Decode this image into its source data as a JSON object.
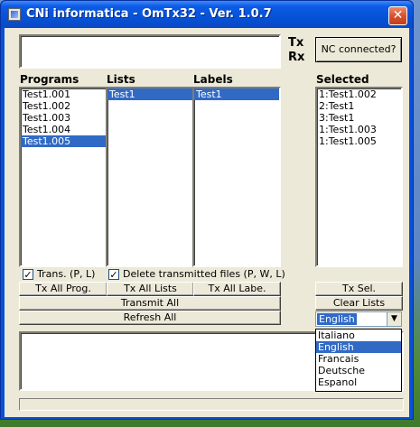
{
  "window": {
    "title": "CNi informatica - OmTx32 - Ver. 1.0.7",
    "close_glyph": "✕"
  },
  "indicators": {
    "tx": "Tx",
    "rx": "Rx"
  },
  "nc_button": "NC connected?",
  "columns": {
    "programs": {
      "label": "Programs",
      "items": [
        "Test1.001",
        "Test1.002",
        "Test1.003",
        "Test1.004",
        "Test1.005"
      ],
      "selected": "Test1.005"
    },
    "lists": {
      "label": "Lists",
      "items": [
        "Test1"
      ],
      "selected": "Test1"
    },
    "labels": {
      "label": "Labels",
      "items": [
        "Test1"
      ],
      "selected": "Test1"
    },
    "selected": {
      "label": "Selected",
      "items": [
        "1:Test1.002",
        "2:Test1",
        "3:Test1",
        "1:Test1.003",
        "1:Test1.005"
      ]
    }
  },
  "checkboxes": {
    "trans": {
      "label": "Trans. (P, L)",
      "checked": true
    },
    "delete": {
      "label": "Delete transmitted files (P, W, L)",
      "checked": true
    }
  },
  "buttons": {
    "tx_all_prog": "Tx All Prog.",
    "tx_all_lists": "Tx All Lists",
    "tx_all_labels": "Tx All Labe.",
    "transmit_all": "Transmit All",
    "refresh_all": "Refresh All",
    "tx_sel": "Tx Sel.",
    "clear_lists": "Clear Lists"
  },
  "language": {
    "value": "English",
    "options": [
      "Italiano",
      "English",
      "Francais",
      "Deutsche",
      "Espanol"
    ]
  },
  "colors": {
    "selection": "#316ac5",
    "face": "#ece9d8",
    "title_blue": "#0a4fd8"
  }
}
